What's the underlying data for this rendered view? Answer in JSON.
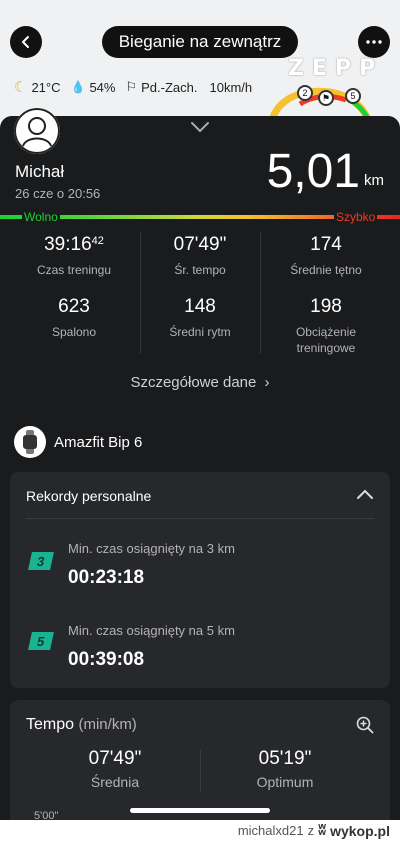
{
  "header": {
    "title": "Bieganie na zewnątrz",
    "back_icon": "chevron-left-icon",
    "more_icon": "ellipsis-icon"
  },
  "weather": {
    "temperature": "21°C",
    "humidity": "54%",
    "wind_direction": "Pd.-Zach.",
    "wind_speed": "10km/h"
  },
  "brand": "ZEPP",
  "map_markers": {
    "marker_a": "2",
    "marker_b": "5"
  },
  "user": {
    "name": "Michał",
    "date": "26 cze o 20:56"
  },
  "distance": {
    "value": "5,01",
    "unit": "km"
  },
  "speed_scale": {
    "slow": "Wolno",
    "fast": "Szybko"
  },
  "metrics": [
    {
      "value": "39:16",
      "value_sup": "42",
      "label": "Czas treningu"
    },
    {
      "value": "07'49\"",
      "label": "Śr. tempo"
    },
    {
      "value": "174",
      "label": "Średnie tętno"
    },
    {
      "value": "623",
      "label": "Spalono"
    },
    {
      "value": "148",
      "label": "Średni rytm"
    },
    {
      "value": "198",
      "label": "Obciążenie treningowe"
    }
  ],
  "details_link": "Szczegółowe dane",
  "device": {
    "name": "Amazfit Bip 6"
  },
  "records": {
    "title": "Rekordy personalne",
    "items": [
      {
        "badge": "3",
        "label": "Min. czas osiągnięty na 3 km",
        "value": "00:23:18"
      },
      {
        "badge": "5",
        "label": "Min. czas osiągnięty na 5 km",
        "value": "00:39:08"
      }
    ]
  },
  "tempo": {
    "title": "Tempo",
    "unit": "(min/km)",
    "average_value": "07'49\"",
    "average_label": "Średnia",
    "optimum_value": "05'19\"",
    "optimum_label": "Optimum",
    "axis_tick": "5'00\""
  },
  "watermark": {
    "user": "michalxd21",
    "sep": "z",
    "site": "wykop.pl"
  },
  "colors": {
    "accent_green": "#19d235",
    "accent_red": "#ee3b25",
    "record_badge": "#1ab391",
    "card_bg": "#1a1b1d"
  }
}
